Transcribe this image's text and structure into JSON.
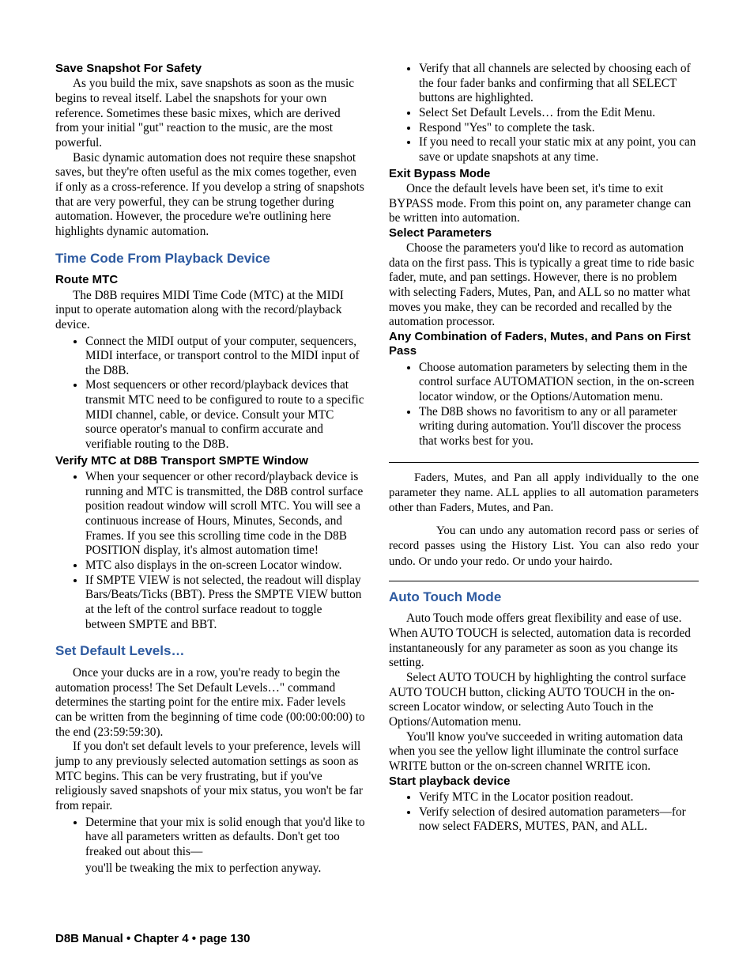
{
  "left": {
    "h_save": "Save Snapshot For Safety",
    "p_save_1": "As you build the mix, save snapshots as soon as the music begins to reveal itself. Label the snapshots for your own reference. Sometimes these basic mixes, which are derived from your initial \"gut\" reaction to the music, are the most powerful.",
    "p_save_2": "Basic dynamic automation does not require these snapshot saves, but they're often useful as the mix comes together, even if only as a cross-reference. If you develop a string of snapshots that are very powerful, they can be strung together during automation. However, the procedure we're outlining here highlights dynamic automation.",
    "h_tc": "Time Code From Playback Device",
    "h_route": "Route MTC",
    "p_route": "The D8B requires MIDI Time Code (MTC) at the MIDI input to operate automation along with the record/playback device.",
    "li_route_1": "Connect the MIDI output of your computer, sequencers, MIDI interface, or transport control to the MIDI input of the D8B.",
    "li_route_2": "Most sequencers or other record/playback devices that transmit MTC need to be configured to route to a specific MIDI channel, cable, or device. Consult your MTC source operator's manual to confirm accurate and verifiable routing to the D8B.",
    "h_verify": "Verify MTC at D8B Transport SMPTE Window",
    "li_verify_1": "When your sequencer or other record/playback device is running and MTC is transmitted, the D8B control surface position readout window will scroll MTC. You will see a continuous increase of Hours, Minutes, Seconds, and Frames. If you see this scrolling time code in the D8B POSITION display, it's almost automation time!",
    "li_verify_2": "MTC also displays in the on-screen Locator window.",
    "li_verify_3": "If SMPTE VIEW is not selected, the readout will display Bars/Beats/Ticks (BBT). Press the SMPTE VIEW button at the left of the control surface readout to toggle between SMPTE and BBT.",
    "h_set": "Set Default Levels…",
    "p_set_1": "Once your ducks are in a row, you're ready to begin the automation process! The Set Default Levels…\" command determines the starting point for the entire mix. Fader levels can be written from the beginning of time code (00:00:00:00) to the end (23:59:59:30).",
    "p_set_2": "If you don't set default levels to your preference, levels will jump to any previously selected automation settings as soon as MTC begins. This can be very frustrating, but if you've religiously saved snapshots of your mix status, you won't be far from repair.",
    "li_set_1": "Determine that your mix is solid enough that you'd like to have all parameters written as defaults. Don't get too freaked out about this—"
  },
  "right": {
    "p_cont": "you'll be tweaking the mix to perfection anyway.",
    "li_r_1": "Verify that all channels are selected by choosing each of the four fader banks and confirming that all SELECT buttons are highlighted.",
    "li_r_2": "Select Set Default Levels… from the Edit Menu.",
    "li_r_3": "Respond \"Yes\" to complete the task.",
    "li_r_4": "If you need to recall your static mix at any point, you can save or update snapshots at any time.",
    "h_exit": "Exit Bypass Mode",
    "p_exit": "Once the default levels have been set, it's time to exit BYPASS mode. From this point on, any parameter change can be written into automation.",
    "h_select": "Select Parameters",
    "p_select": "Choose the parameters you'd like to record as automation data on the first pass. This is typically a great time to ride basic fader, mute, and pan settings. However,  there is no problem with selecting Faders, Mutes, Pan, and ALL so no matter what moves you make, they can be recorded and recalled by the automation processor.",
    "h_combo": "Any Combination of Faders, Mutes, and Pans on First Pass",
    "li_combo_1": "Choose automation parameters by selecting them in the control surface AUTOMATION section, in the on-screen locator window, or the Options/Automation menu.",
    "li_combo_2": "The D8B shows no favoritism to any or all parameter writing during automation. You'll discover the process that works best for you.",
    "note_1": "Faders, Mutes, and Pan all apply individually to the one parameter they name. ALL applies to all automation parameters other than Faders, Mutes, and Pan.",
    "note_2": "You can undo any automation record pass or series of record passes using the History List. You can also redo your undo. Or undo your redo. Or undo your hairdo.",
    "h_auto": "Auto Touch Mode",
    "p_auto_1": "Auto Touch mode offers great flexibility and ease of use. When AUTO TOUCH is selected, automation data is recorded instantaneously for any parameter as soon as you change its setting.",
    "p_auto_2": "Select AUTO TOUCH by highlighting the control surface AUTO TOUCH button, clicking AUTO TOUCH in the on-screen Locator window, or selecting Auto Touch in the Options/Automation menu.",
    "p_auto_3": "You'll know you've succeeded in writing automation data when you see the yellow light illuminate the control surface WRITE button or the on-screen channel WRITE icon.",
    "h_start": "Start playback device",
    "li_start_1": "Verify MTC in the Locator position readout.",
    "li_start_2": "Verify selection of desired automation parameters—for now select FADERS, MUTES, PAN, and ALL."
  },
  "footer": "D8B Manual • Chapter 4 • page  130"
}
